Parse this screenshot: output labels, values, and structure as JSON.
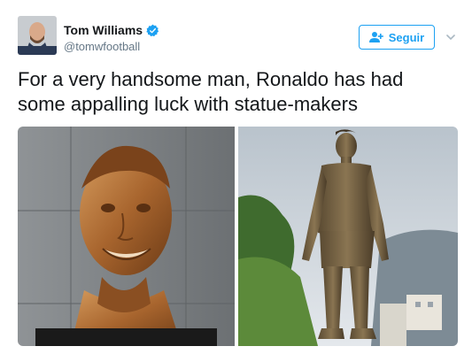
{
  "author": {
    "name": "Tom Williams",
    "handle": "@tomwfootball",
    "verified": true
  },
  "actions": {
    "follow_label": "Seguir"
  },
  "tweet": {
    "text_line1": "For a very handsome man, Ronaldo has had",
    "text_line2": "some appalling luck with statue-makers"
  },
  "media": [
    {
      "name": "bust-photo",
      "description_icon": "bronze-bust-image"
    },
    {
      "name": "statue-photo",
      "description_icon": "bronze-statue-image"
    }
  ],
  "colors": {
    "accent": "#1da1f2",
    "text": "#14171a",
    "muted": "#657786"
  }
}
